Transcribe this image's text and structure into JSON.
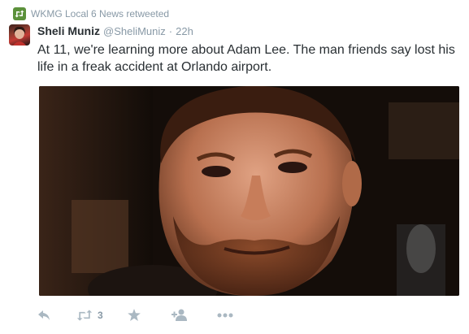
{
  "retweet_context": {
    "text": "WKMG Local 6 News retweeted",
    "icon": "retweet-icon"
  },
  "tweet": {
    "author_name": "Sheli Muniz",
    "author_handle": "@SheliMuniz",
    "separator": "·",
    "timestamp": "22h",
    "text": "At 11, we're learning more about Adam Lee. The man friends say lost his life in a freak accident at Orlando airport.",
    "avatar_icon": "avatar"
  },
  "media": {
    "icon": "photo"
  },
  "actions": {
    "reply_icon": "reply-icon",
    "retweet_icon": "retweet-icon",
    "retweet_count": "3",
    "favorite_icon": "star-icon",
    "follow_icon": "add-user-icon",
    "more_icon": "more-icon"
  },
  "colors": {
    "text": "#292f33",
    "muted": "#8899a6",
    "icon_gray": "#aab8c2",
    "retweet_green": "#5c913b"
  }
}
